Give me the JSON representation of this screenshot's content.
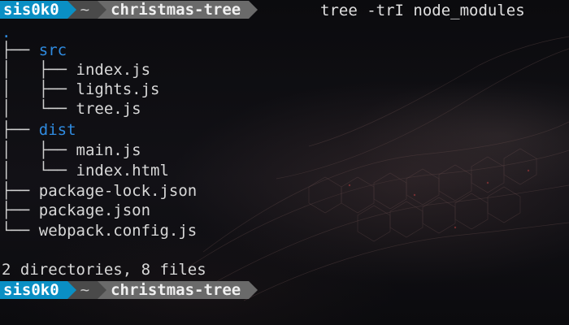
{
  "prompt": {
    "user": "sis0k0",
    "home": "~",
    "directory": "christmas-tree"
  },
  "command": "tree -trI node_modules",
  "tree": {
    "root": ".",
    "lines": [
      {
        "branch": "├── ",
        "name": "src",
        "kind": "dir"
      },
      {
        "branch": "│   ├── ",
        "name": "index.js",
        "kind": "file"
      },
      {
        "branch": "│   ├── ",
        "name": "lights.js",
        "kind": "file"
      },
      {
        "branch": "│   └── ",
        "name": "tree.js",
        "kind": "file"
      },
      {
        "branch": "├── ",
        "name": "dist",
        "kind": "dir"
      },
      {
        "branch": "│   ├── ",
        "name": "main.js",
        "kind": "file"
      },
      {
        "branch": "│   └── ",
        "name": "index.html",
        "kind": "file"
      },
      {
        "branch": "├── ",
        "name": "package-lock.json",
        "kind": "file"
      },
      {
        "branch": "├── ",
        "name": "package.json",
        "kind": "file"
      },
      {
        "branch": "└── ",
        "name": "webpack.config.js",
        "kind": "file"
      }
    ]
  },
  "summary": "2 directories, 8 files",
  "colors": {
    "user_segment": "#0a8fc4",
    "home_segment": "#4a4a4a",
    "dir_segment": "#6a6a6a",
    "directory_text": "#2f8be0"
  }
}
